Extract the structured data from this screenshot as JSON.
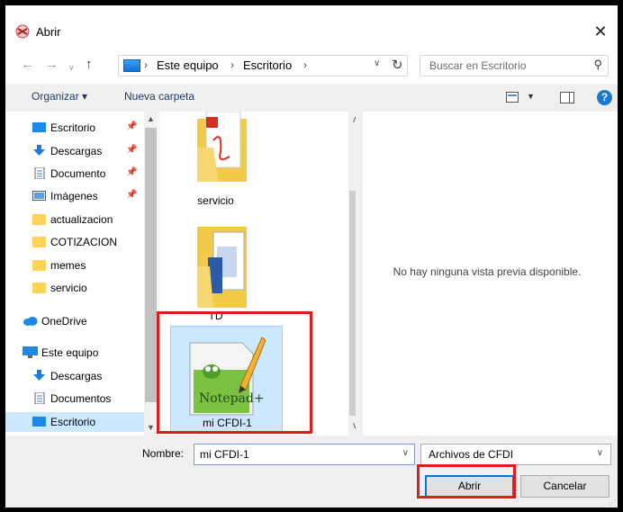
{
  "window": {
    "title": "Abrir",
    "close_glyph": "✕"
  },
  "nav": {
    "back_icon": "arrow-left-icon",
    "forward_icon": "arrow-right-icon",
    "history_icon": "chevron-down-icon",
    "up_icon": "arrow-up-icon",
    "breadcrumbs": [
      "Este equipo",
      "Escritorio"
    ],
    "refresh_icon": "refresh-icon",
    "search_placeholder": "Buscar en Escritorio"
  },
  "toolbar": {
    "organize": "Organizar ▾",
    "new_folder": "Nueva carpeta",
    "help": "?"
  },
  "sidebar": {
    "items": [
      {
        "label": "Escritorio",
        "icon": "desktop-icon",
        "pinned": true
      },
      {
        "label": "Descargas",
        "icon": "download-icon",
        "pinned": true
      },
      {
        "label": "Documento",
        "icon": "document-icon",
        "pinned": true
      },
      {
        "label": "Imágenes",
        "icon": "pictures-icon",
        "pinned": true
      },
      {
        "label": "actualizacion",
        "icon": "folder-icon",
        "pinned": false
      },
      {
        "label": "COTIZACION",
        "icon": "folder-icon",
        "pinned": false
      },
      {
        "label": "memes",
        "icon": "folder-icon",
        "pinned": false
      },
      {
        "label": "servicio",
        "icon": "folder-icon",
        "pinned": false
      },
      {
        "label": "OneDrive",
        "icon": "cloud-icon",
        "pinned": false
      },
      {
        "label": "Este equipo",
        "icon": "computer-icon",
        "pinned": false
      },
      {
        "label": "Descargas",
        "icon": "download-icon",
        "pinned": false
      },
      {
        "label": "Documentos",
        "icon": "document-icon",
        "pinned": false
      },
      {
        "label": "Escritorio",
        "icon": "desktop-icon",
        "pinned": false,
        "selected": true
      }
    ]
  },
  "files": [
    {
      "name": "servicio",
      "icon": "pdf-folder-icon"
    },
    {
      "name": "TD",
      "icon": "folder-icon"
    },
    {
      "name": "mi CFDI-1",
      "icon": "notepadpp-file-icon",
      "selected": true
    }
  ],
  "preview": {
    "message": "No hay ninguna vista previa disponible."
  },
  "footer": {
    "name_label": "Nombre:",
    "name_value": "mi CFDI-1",
    "filter_value": "Archivos de CFDI",
    "open_button": "Abrir",
    "cancel_button": "Cancelar"
  },
  "colors": {
    "highlight": "#e01b1b",
    "selection": "#cce8ff",
    "accent": "#0078d7"
  }
}
